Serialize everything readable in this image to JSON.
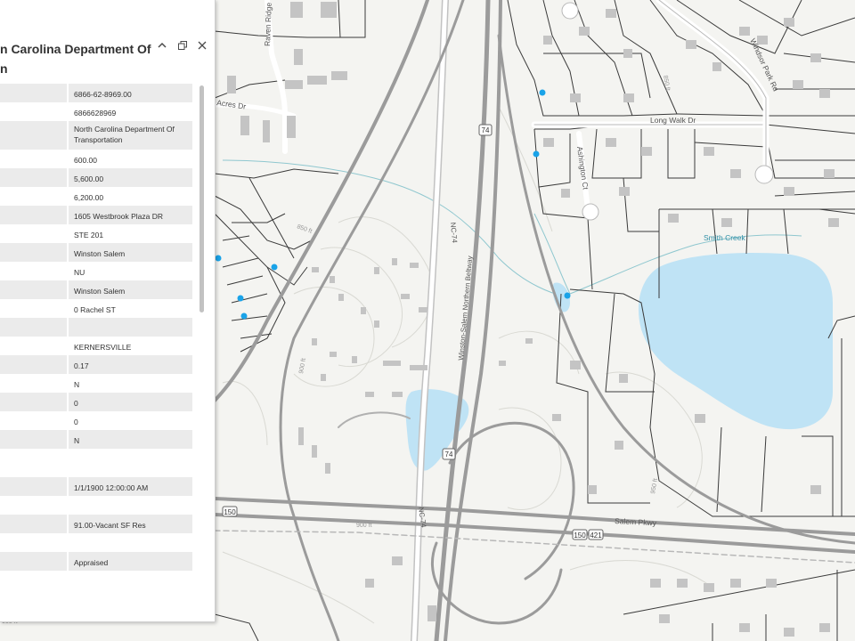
{
  "panel": {
    "title_line1": "n Carolina Department Of",
    "title_line2": "n",
    "rows": [
      "6866-62-8969.00",
      "6866628969",
      "North Carolina Department Of Transportation",
      "600.00",
      "5,600.00",
      "6,200.00",
      "1605 Westbrook Plaza DR",
      "STE 201",
      "Winston Salem",
      "NU",
      "Winston Salem",
      "0 Rachel ST",
      "",
      "KERNERSVILLE",
      "0.17",
      "N",
      "0",
      "0",
      "N",
      "",
      "1/1/1900 12:00:00 AM",
      "",
      "91.00-Vacant SF Res",
      "",
      "Appraised",
      ""
    ]
  },
  "map": {
    "labels": {
      "raven_ridge": "Raven Ridge Dr",
      "acres": "Acres Dr",
      "long_walk": "Long Walk Dr",
      "ashington": "Ashington Ct",
      "windsor_park": "Windsor Park Rd",
      "smith_creek": "Smith Creek",
      "nc74_a": "NC-74",
      "nc74_b": "NC-74",
      "winston_pkwy": "Winston-Salem Northern Beltway",
      "salem_pkwy": "Salem Pkwy",
      "shield_74a": "74",
      "shield_74b": "74",
      "shield_150a": "150",
      "shield_150b": "150",
      "shield_421": "421",
      "c_850": "850 ft",
      "c_900": "900 ft",
      "c_900b": "900 ft",
      "c_950": "950 ft",
      "c_900c": "900 ft",
      "c_850b": "850 ft"
    },
    "colors": {
      "water": "#bfe3f5",
      "road": "#9a9a9a",
      "parcel": "#333333",
      "point": "#1aa3e8"
    }
  }
}
